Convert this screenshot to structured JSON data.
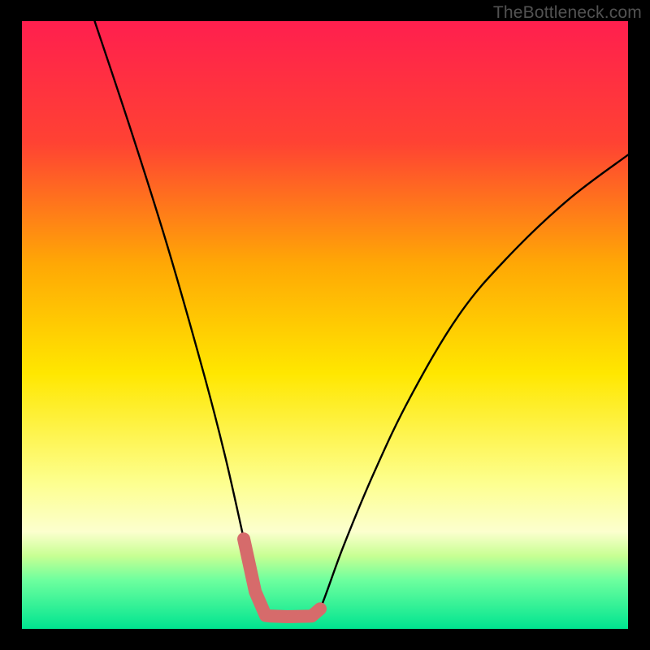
{
  "watermark": "TheBottleneck.com",
  "chart_data": {
    "type": "line",
    "title": "",
    "xlabel": "",
    "ylabel": "",
    "xlim": [
      0,
      100
    ],
    "ylim": [
      0,
      100
    ],
    "series": [
      {
        "name": "black-curve",
        "x": [
          12,
          18,
          24,
          30,
          33.5,
          36.6,
          38.5,
          40.2,
          41.1,
          43.8,
          47.8,
          49.2,
          53,
          58,
          64,
          72,
          80,
          90,
          100
        ],
        "y": [
          100,
          82,
          63,
          42,
          28.5,
          14.8,
          6.1,
          2.2,
          2.1,
          2.0,
          2.1,
          3.3,
          13.5,
          25.5,
          38,
          51.5,
          61,
          70.5,
          78
        ]
      },
      {
        "name": "pink-segment",
        "x": [
          36.6,
          38.5,
          40.2,
          41.1,
          43.8,
          47.8,
          49.2
        ],
        "y": [
          14.8,
          6.1,
          2.2,
          2.1,
          2.0,
          2.1,
          3.3
        ]
      }
    ],
    "gradient_stops": [
      {
        "offset": 0,
        "color": "#ff1f4e"
      },
      {
        "offset": 20,
        "color": "#ff4233"
      },
      {
        "offset": 40,
        "color": "#ffa805"
      },
      {
        "offset": 58,
        "color": "#ffe700"
      },
      {
        "offset": 76,
        "color": "#fdff8f"
      },
      {
        "offset": 84,
        "color": "#fcffce"
      },
      {
        "offset": 88,
        "color": "#c7ff93"
      },
      {
        "offset": 92,
        "color": "#6dff9e"
      },
      {
        "offset": 100,
        "color": "#00e490"
      }
    ]
  }
}
